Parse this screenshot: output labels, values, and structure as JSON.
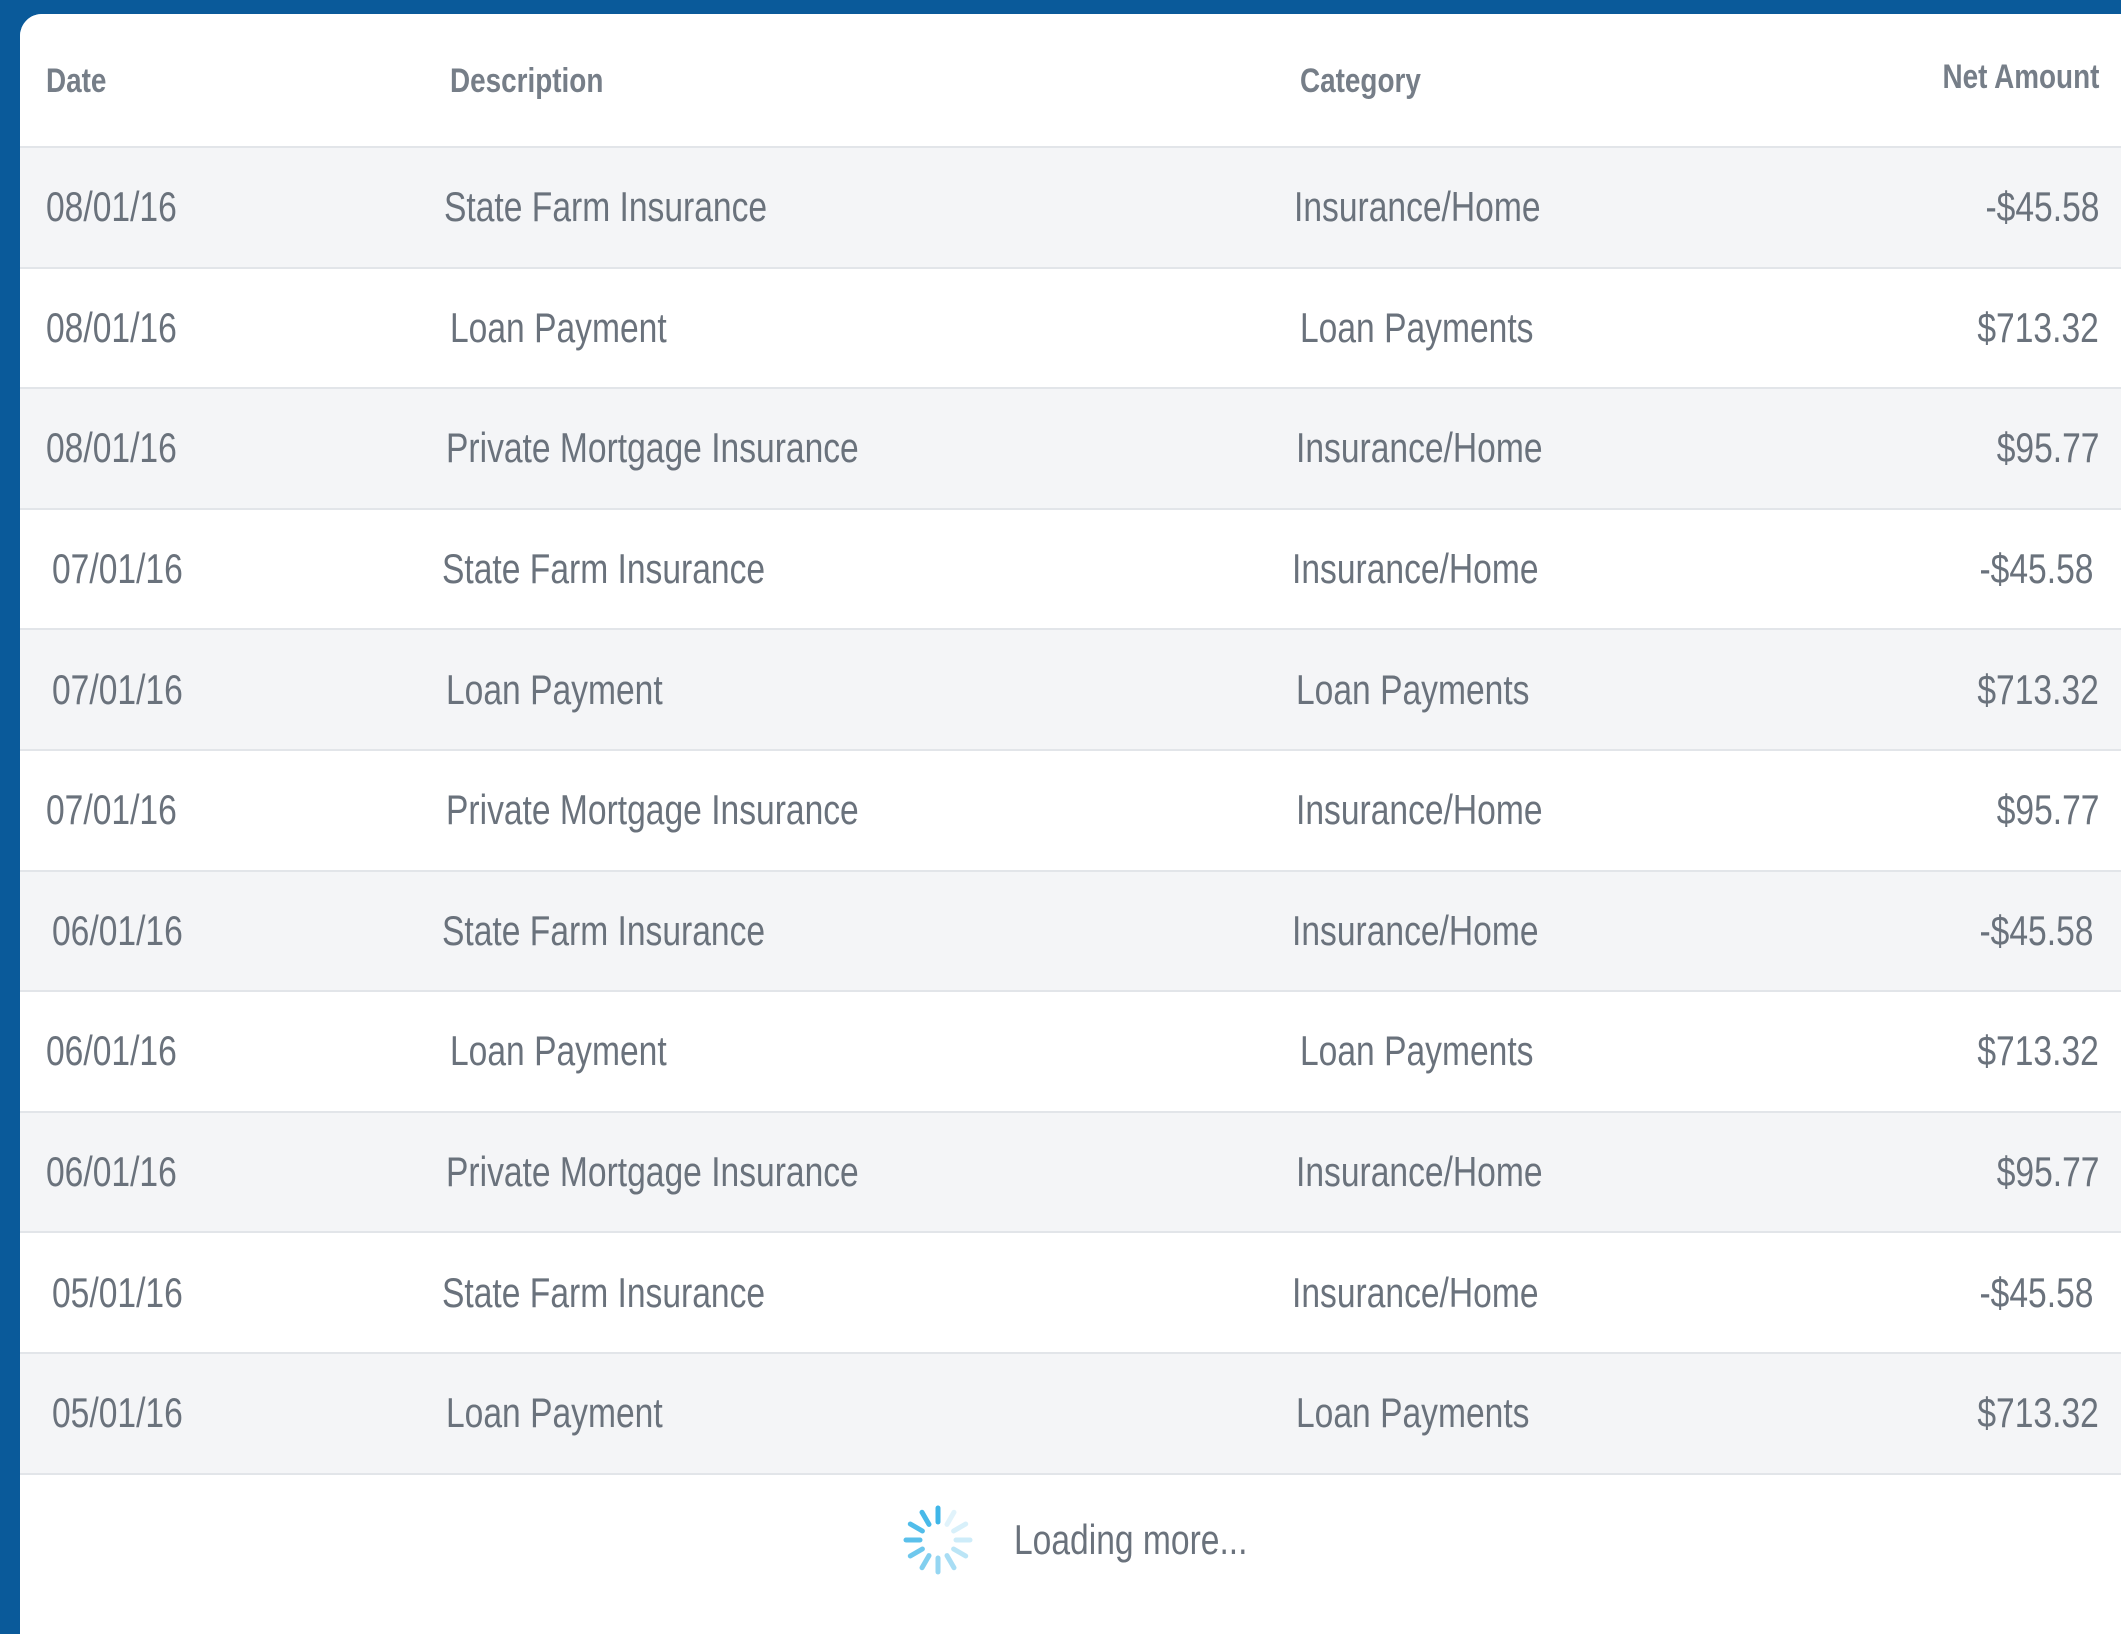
{
  "table": {
    "columns": {
      "date": "Date",
      "description": "Description",
      "category": "Category",
      "net_amount": "Net Amount"
    },
    "rows": [
      {
        "date": "08/01/16",
        "description": "State Farm Insurance",
        "category": "Insurance/Home",
        "amount": "-$45.58"
      },
      {
        "date": "08/01/16",
        "description": "Loan Payment",
        "category": "Loan Payments",
        "amount": "$713.32"
      },
      {
        "date": "08/01/16",
        "description": "Private Mortgage Insurance",
        "category": "Insurance/Home",
        "amount": "$95.77"
      },
      {
        "date": "07/01/16",
        "description": "State Farm Insurance",
        "category": "Insurance/Home",
        "amount": "-$45.58"
      },
      {
        "date": "07/01/16",
        "description": "Loan Payment",
        "category": "Loan Payments",
        "amount": "$713.32"
      },
      {
        "date": "07/01/16",
        "description": "Private Mortgage Insurance",
        "category": "Insurance/Home",
        "amount": "$95.77"
      },
      {
        "date": "06/01/16",
        "description": "State Farm Insurance",
        "category": "Insurance/Home",
        "amount": "-$45.58"
      },
      {
        "date": "06/01/16",
        "description": "Loan Payment",
        "category": "Loan Payments",
        "amount": "$713.32"
      },
      {
        "date": "06/01/16",
        "description": "Private Mortgage Insurance",
        "category": "Insurance/Home",
        "amount": "$95.77"
      },
      {
        "date": "05/01/16",
        "description": "State Farm Insurance",
        "category": "Insurance/Home",
        "amount": "-$45.58"
      },
      {
        "date": "05/01/16",
        "description": "Loan Payment",
        "category": "Loan Payments",
        "amount": "$713.32"
      }
    ]
  },
  "footer": {
    "loading_text": "Loading more...",
    "spinner_icon": "spinner-icon"
  },
  "colors": {
    "frame": "#0a5a9a",
    "spinner": "#3fb6e8",
    "text": "#6a727c",
    "header_text": "#767e88",
    "row_alt": "#f4f5f7"
  }
}
